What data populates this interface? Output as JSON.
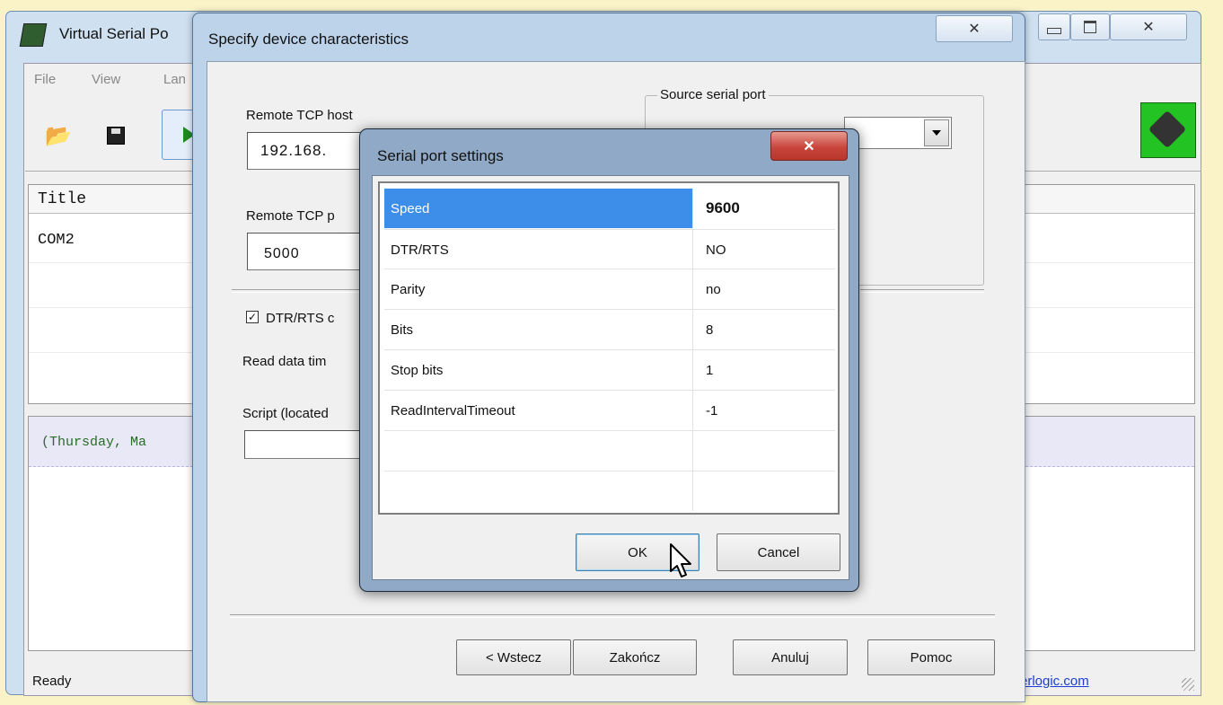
{
  "main_window": {
    "title": "Virtual Serial Po",
    "menu": [
      "File",
      "View",
      "Lan"
    ],
    "table_header": "Title",
    "rows": [
      "COM2"
    ],
    "log_text": "(Thursday, Ma",
    "status": "Ready",
    "link_fragment": "erlogic.com"
  },
  "wizard": {
    "title": "Specify device characteristics",
    "remote_host_label": "Remote TCP host",
    "remote_host_value": "192.168.",
    "remote_port_label": "Remote TCP p",
    "remote_port_value": "5000",
    "source_serial_port_label": "Source serial port",
    "dtr_rts_label": "DTR/RTS c",
    "dtr_rts_checked": true,
    "read_timeout_label": "Read data tim",
    "script_label": "Script (located",
    "buttons": {
      "back": "< Wstecz",
      "finish": "Zakończ",
      "cancel": "Anuluj",
      "help": "Pomoc"
    }
  },
  "serial_dialog": {
    "title": "Serial port settings",
    "properties": [
      {
        "name": "Speed",
        "value": "9600",
        "selected": true
      },
      {
        "name": "DTR/RTS",
        "value": "NO"
      },
      {
        "name": "Parity",
        "value": "no"
      },
      {
        "name": "Bits",
        "value": "8"
      },
      {
        "name": "Stop bits",
        "value": "1"
      },
      {
        "name": "ReadIntervalTimeout",
        "value": "-1"
      }
    ],
    "ok_label": "OK",
    "cancel_label": "Cancel"
  },
  "colors": {
    "selection": "#3d8ee8",
    "close_button": "#c9463d",
    "log_background": "#e8e8f6"
  }
}
